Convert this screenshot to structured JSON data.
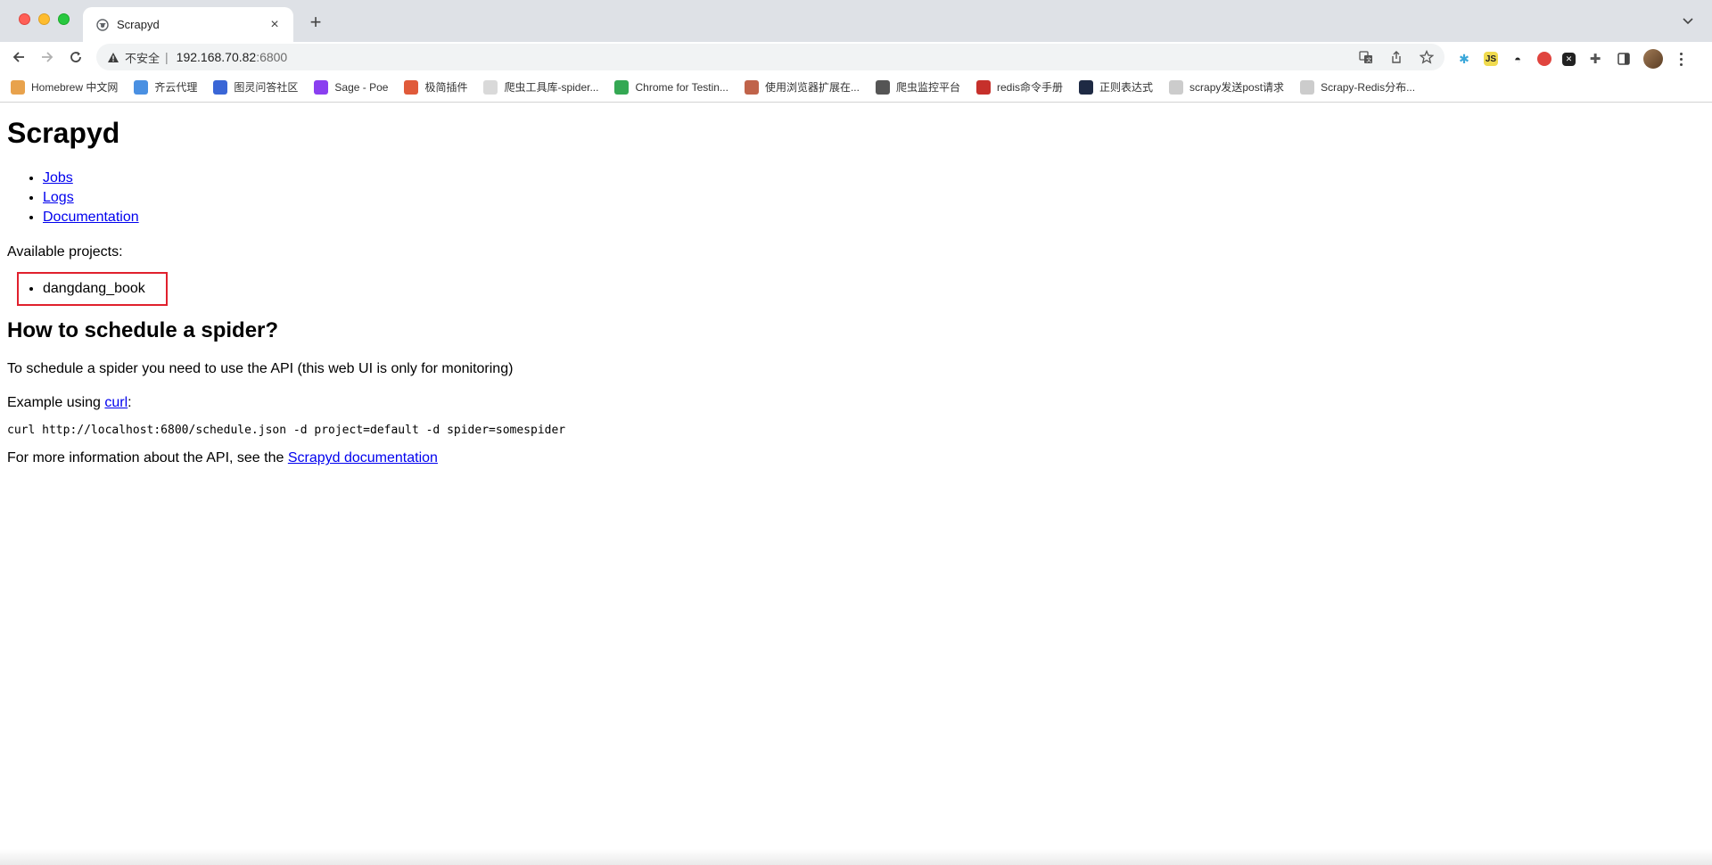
{
  "browser": {
    "tab": {
      "title": "Scrapyd",
      "favicon": "globe-icon"
    },
    "new_tab": "+",
    "omnibox": {
      "insecure_label": "不安全",
      "host": "192.168.70.82",
      "port": ":6800"
    },
    "bookmarks": [
      {
        "label": "Homebrew 中文网",
        "icon": "homebrew-icon",
        "color": "#e8a24c"
      },
      {
        "label": "齐云代理",
        "icon": "cloud-icon",
        "color": "#4a90e2"
      },
      {
        "label": "图灵问答社区",
        "icon": "turing-icon",
        "color": "#3a66d6"
      },
      {
        "label": "Sage - Poe",
        "icon": "poe-icon",
        "color": "#8a3ff0"
      },
      {
        "label": "极简插件",
        "icon": "rainbow-icon",
        "color": "#e05a3a"
      },
      {
        "label": "爬虫工具库-spider...",
        "icon": "spider-icon",
        "color": "#d9d9d9"
      },
      {
        "label": "Chrome for Testin...",
        "icon": "chrome-icon",
        "color": "#34a853"
      },
      {
        "label": "使用浏览器扩展在...",
        "icon": "avatar-icon",
        "color": "#c0634a"
      },
      {
        "label": "爬虫监控平台",
        "icon": "globe-icon",
        "color": "#555555"
      },
      {
        "label": "redis命令手册",
        "icon": "redis-icon",
        "color": "#c6302b"
      },
      {
        "label": "正则表达式",
        "icon": "regex-icon",
        "color": "#1e2a44"
      },
      {
        "label": "scrapy发送post请求",
        "icon": "feather-icon",
        "color": "#cccccc"
      },
      {
        "label": "Scrapy-Redis分布...",
        "icon": "document-icon",
        "color": "#cccccc"
      }
    ]
  },
  "page": {
    "title": "Scrapyd",
    "nav_links": [
      "Jobs",
      "Logs",
      "Documentation"
    ],
    "available_label": "Available projects:",
    "projects": [
      "dangdang_book"
    ],
    "schedule_heading": "How to schedule a spider?",
    "schedule_text": "To schedule a spider you need to use the API (this web UI is only for monitoring)",
    "example_prefix": "Example using ",
    "example_link": "curl",
    "example_suffix": ":",
    "code": "curl http://localhost:6800/schedule.json -d project=default -d spider=somespider",
    "more_prefix": "For more information about the API, see the ",
    "more_link": "Scrapyd documentation"
  }
}
